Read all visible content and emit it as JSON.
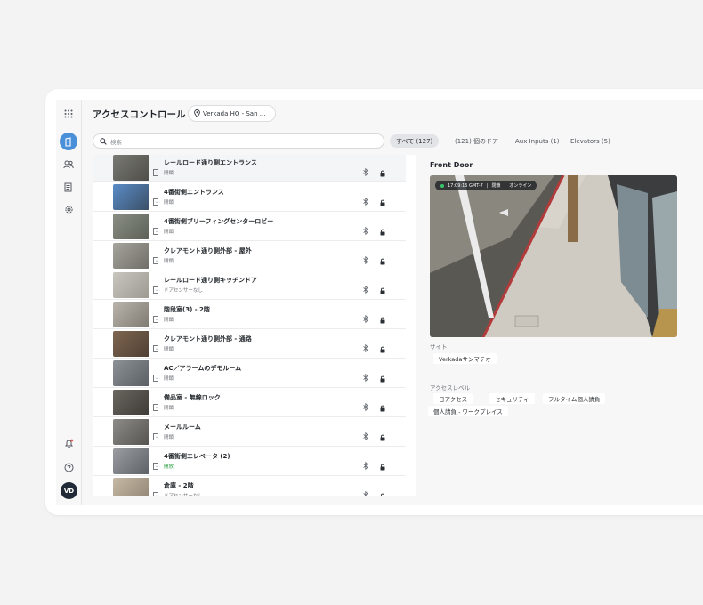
{
  "app": {
    "title": "アクセスコントロール",
    "site_selector": "Verkada HQ - San ..."
  },
  "rail": {
    "icons": [
      "grid-icon",
      "door-icon",
      "users-icon",
      "report-icon",
      "settings-icon",
      "bell-icon",
      "help-icon"
    ],
    "avatar_initials": "VD"
  },
  "search": {
    "placeholder": "検索"
  },
  "filters": [
    {
      "label": "すべて (127)",
      "active": true
    },
    {
      "label": "(121) 個のドア",
      "active": false
    },
    {
      "label": "Aux Inputs (1)",
      "active": false
    },
    {
      "label": "Elevators (5)",
      "active": false
    }
  ],
  "doors": [
    {
      "name": "レールロード通り側エントランス",
      "status": "閉鎖",
      "status_color": "#6d7177"
    },
    {
      "name": "4番街側エントランス",
      "status": "閉鎖",
      "status_color": "#6d7177"
    },
    {
      "name": "4番街側ブリーフィングセンターロビー",
      "status": "閉鎖",
      "status_color": "#6d7177"
    },
    {
      "name": "クレアモント通り側外部 - 屋外",
      "status": "閉鎖",
      "status_color": "#6d7177"
    },
    {
      "name": "レールロード通り側キッチンドア",
      "status": "ドアセンサーなし",
      "status_color": "#6d7177"
    },
    {
      "name": "階段室(3) - 2階",
      "status": "閉鎖",
      "status_color": "#6d7177"
    },
    {
      "name": "クレアモント通り側外部 - 通路",
      "status": "閉鎖",
      "status_color": "#6d7177"
    },
    {
      "name": "AC／アラームのデモルーム",
      "status": "閉鎖",
      "status_color": "#6d7177"
    },
    {
      "name": "備品室 - 無線ロック",
      "status": "閉鎖",
      "status_color": "#6d7177"
    },
    {
      "name": "メールルーム",
      "status": "閉鎖",
      "status_color": "#6d7177"
    },
    {
      "name": "4番街側エレベータ (2)",
      "status": "開放",
      "status_color": "#2ea043"
    },
    {
      "name": "倉庫 - 2階",
      "status": "ドアセンサーなし",
      "status_color": "#6d7177"
    }
  ],
  "detail": {
    "title": "Front Door",
    "video_badge": {
      "time": "17:09:15 GMT-7",
      "door_state": "閉鎖",
      "online": "オンライン"
    },
    "site_label": "サイト",
    "site_value": "Verkadaサンマテオ",
    "access_label": "アクセスレベル",
    "access_levels": [
      "日アクセス",
      "セキュリティ",
      "フルタイム個人請負",
      "個人請負 - ワークプレイス"
    ]
  },
  "colors": {
    "accent": "#4a90d9",
    "online_dot": "#39c46a"
  }
}
